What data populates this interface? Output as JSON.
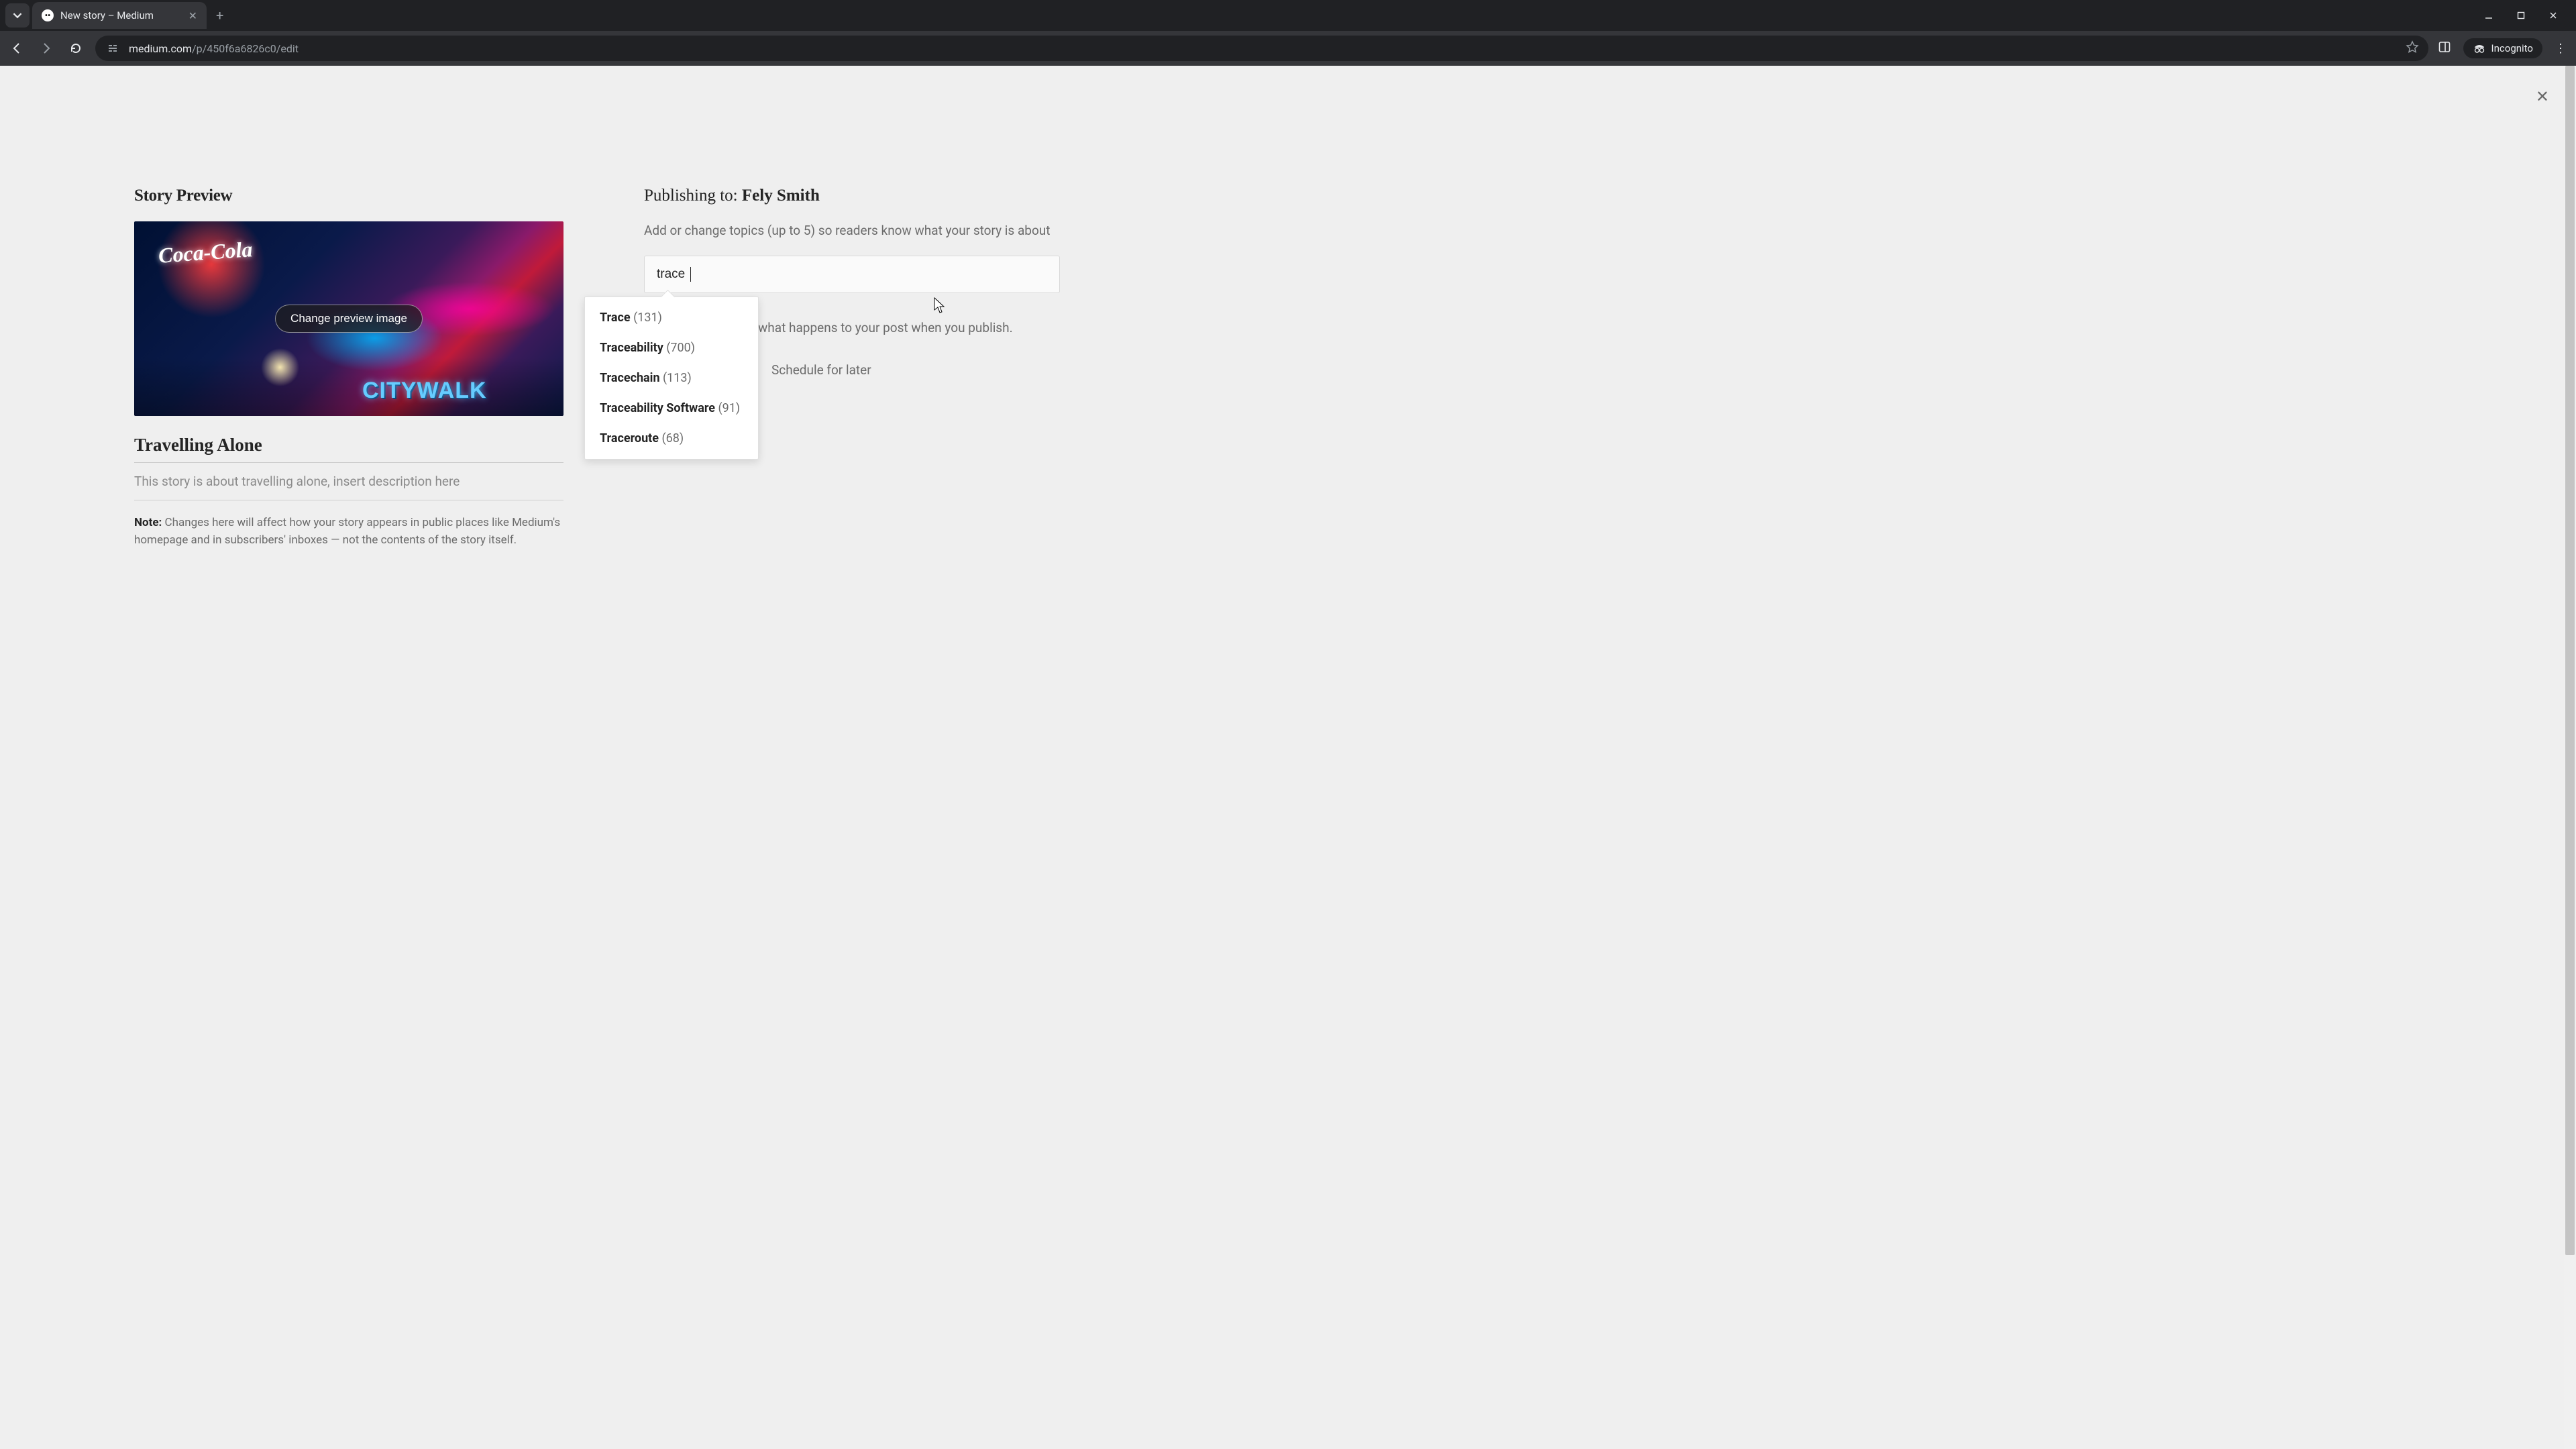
{
  "browser": {
    "tab_title": "New story – Medium",
    "url_domain": "medium.com",
    "url_path": "/p/450f6a6826c0/edit",
    "incognito_label": "Incognito"
  },
  "modal": {
    "left": {
      "heading": "Story Preview",
      "change_image_btn": "Change preview image",
      "image_logo_top": "Coca-Cola",
      "image_logo_bottom": "CITYWALK",
      "title": "Travelling Alone",
      "description": "This story is about travelling alone, insert description here",
      "note_label": "Note:",
      "note_body": " Changes here will affect how your story appears in public places like Medium's homepage and in subscribers' inboxes — not the contents of the story itself."
    },
    "right": {
      "publishing_prefix": "Publishing to: ",
      "publishing_author": "Fely Smith",
      "topics_hint": "Add or change topics (up to 5) so readers know what your story is about",
      "topic_input_value": "trace",
      "autocomplete": [
        {
          "label": "Trace",
          "count": "(131)"
        },
        {
          "label": "Traceability",
          "count": "(700)"
        },
        {
          "label": "Tracechain",
          "count": "(113)"
        },
        {
          "label": "Traceability Software",
          "count": "(91)"
        },
        {
          "label": "Traceroute",
          "count": "(68)"
        }
      ],
      "learn_more_visible_fragment": "what happens to your post when you publish.",
      "schedule_label": "Schedule for later"
    }
  }
}
